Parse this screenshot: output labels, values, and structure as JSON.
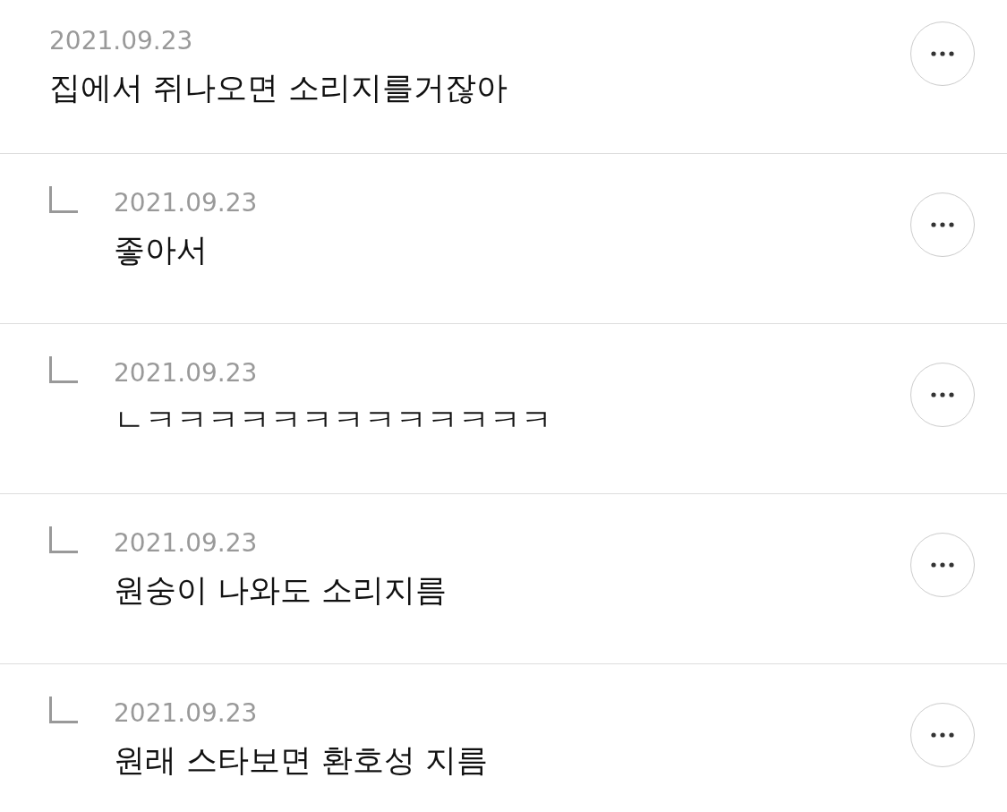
{
  "comment": {
    "date": "2021.09.23",
    "text": "집에서 쥐나오면 소리지를거잖아",
    "children": [
      {
        "date": "2021.09.23",
        "text": "좋아서"
      },
      {
        "date": "2021.09.23",
        "text": "ㄴㅋㅋㅋㅋㅋㅋㅋㅋㅋㅋㅋㅋㅋ"
      },
      {
        "date": "2021.09.23",
        "text": "원숭이 나와도 소리지름"
      },
      {
        "date": "2021.09.23",
        "text": "원래 스타보면 환호성 지름"
      }
    ]
  }
}
